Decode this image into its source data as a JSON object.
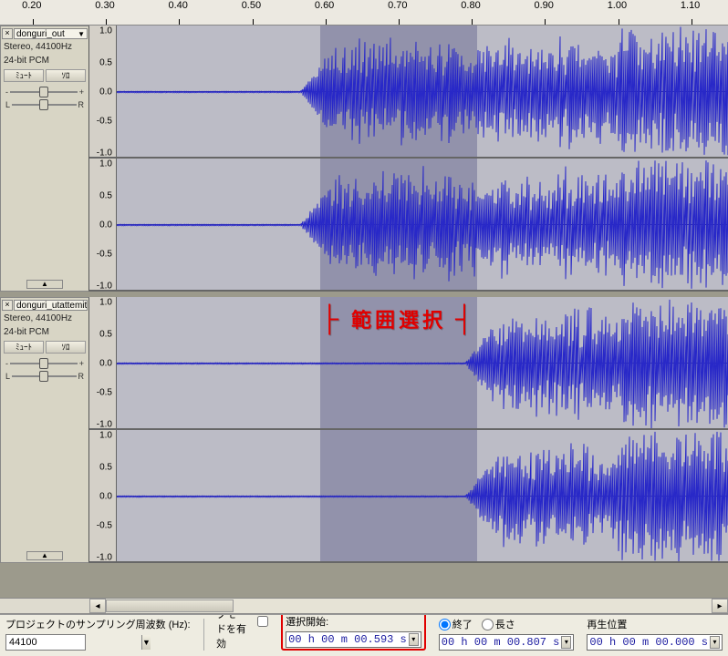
{
  "ruler": {
    "ticks": [
      {
        "pos": 0.2,
        "label": "0.20"
      },
      {
        "pos": 0.3,
        "label": "0.30"
      },
      {
        "pos": 0.4,
        "label": "0.40"
      },
      {
        "pos": 0.5,
        "label": "0.50"
      },
      {
        "pos": 0.6,
        "label": "0.60"
      },
      {
        "pos": 0.7,
        "label": "0.70"
      },
      {
        "pos": 0.8,
        "label": "0.80"
      },
      {
        "pos": 0.9,
        "label": "0.90"
      },
      {
        "pos": 1.0,
        "label": "1.00"
      },
      {
        "pos": 1.1,
        "label": "1.10"
      }
    ],
    "left_time": 0.155,
    "right_time": 1.15
  },
  "tracks": {
    "amp_labels": [
      "1.0",
      "0.5",
      "0.0",
      "-0.5",
      "-1.0"
    ],
    "list": [
      {
        "name": "donguri_out",
        "format": "Stereo, 44100Hz",
        "bitdepth": "24-bit PCM",
        "mute": "ﾐｭｰﾄ",
        "solo": "ｿﾛ",
        "gain_left": "-",
        "gain_right": "+",
        "pan_left": "L",
        "pan_right": "R"
      },
      {
        "name": "donguri_utattemit",
        "format": "Stereo, 44100Hz",
        "bitdepth": "24-bit PCM",
        "mute": "ﾐｭｰﾄ",
        "solo": "ｿﾛ",
        "gain_left": "-",
        "gain_right": "+",
        "pan_left": "L",
        "pan_right": "R"
      }
    ]
  },
  "selection": {
    "start_time": 0.593,
    "end_time": 0.807
  },
  "overlay": {
    "text": "範囲選択"
  },
  "bottombar": {
    "project_rate_label": "プロジェクトのサンプリング周波数 (Hz):",
    "project_rate_value": "44100",
    "snap_label": "スナップモードを有効",
    "sel_start_label": "選択開始:",
    "sel_start_value": "00 h 00 m 00.593 s",
    "end_radio": "終了",
    "length_radio": "長さ",
    "sel_end_value": "00 h 00 m 00.807 s",
    "play_pos_label": "再生位置",
    "play_pos_value": "00 h 00 m 00.000 s"
  }
}
